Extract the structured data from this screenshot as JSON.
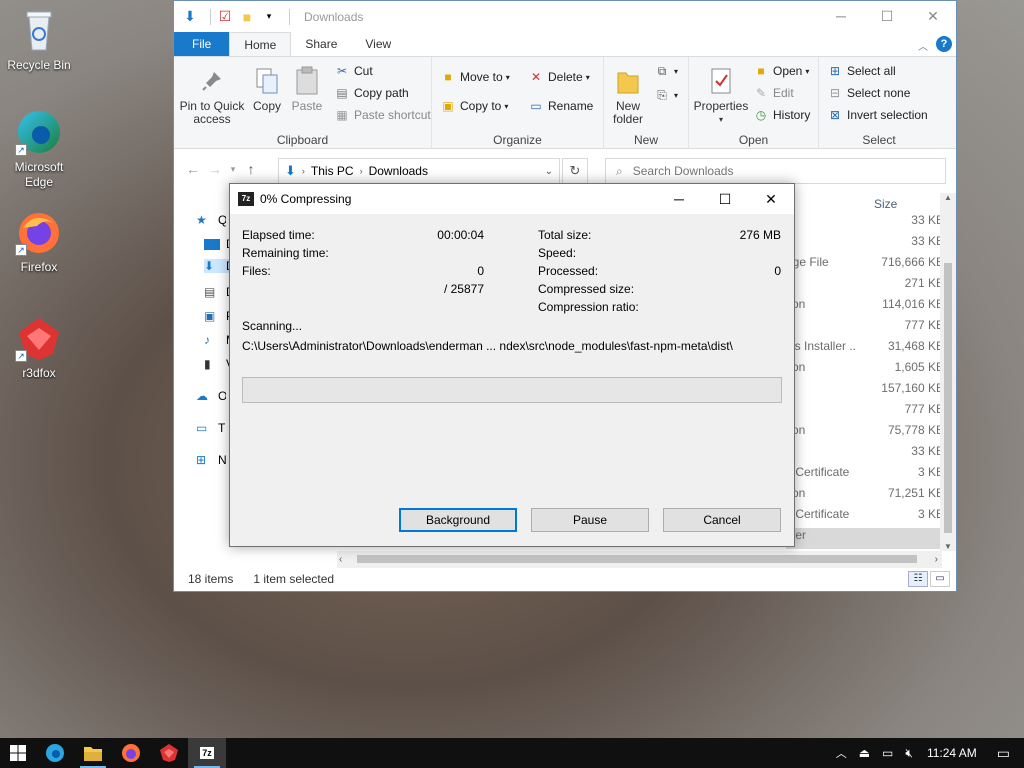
{
  "desktop": {
    "icons": [
      {
        "label": "Recycle Bin",
        "icon": "recycle-bin-icon"
      },
      {
        "label": "Microsoft Edge",
        "icon": "edge-icon"
      },
      {
        "label": "Firefox",
        "icon": "firefox-icon"
      },
      {
        "label": "r3dfox",
        "icon": "r3dfox-icon"
      }
    ]
  },
  "explorer": {
    "title": "Downloads",
    "tabs": [
      "File",
      "Home",
      "Share",
      "View"
    ],
    "active_tab": "Home",
    "ribbon": {
      "clipboard": {
        "label": "Clipboard",
        "pin": "Pin to Quick access",
        "copy": "Copy",
        "paste": "Paste",
        "cut": "Cut",
        "copy_path": "Copy path",
        "paste_shortcut": "Paste shortcut"
      },
      "organize": {
        "label": "Organize",
        "move_to": "Move to",
        "copy_to": "Copy to",
        "delete": "Delete",
        "rename": "Rename"
      },
      "new": {
        "label": "New",
        "new_folder": "New folder"
      },
      "open": {
        "label": "Open",
        "properties": "Properties",
        "open": "Open",
        "edit": "Edit",
        "history": "History"
      },
      "select": {
        "label": "Select",
        "select_all": "Select all",
        "select_none": "Select none",
        "invert": "Invert selection"
      }
    },
    "address": {
      "crumbs": [
        "This PC",
        "Downloads"
      ],
      "search_placeholder": "Search Downloads"
    },
    "nav_items": [
      "Qu",
      "D",
      "D",
      "D",
      "P",
      "M",
      "V",
      "On",
      "Th",
      "Ne"
    ],
    "columns": {
      "size": "Size"
    },
    "rows": [
      {
        "type": "",
        "size": "33 KB"
      },
      {
        "type": "",
        "size": "33 KB"
      },
      {
        "type": "age File",
        "size": "716,666 KB"
      },
      {
        "type": "e",
        "size": "271 KB"
      },
      {
        "type": "tion",
        "size": "114,016 KB"
      },
      {
        "type": "e",
        "size": "777 KB"
      },
      {
        "type": "ws Installer ...",
        "size": "31,468 KB"
      },
      {
        "type": "tion",
        "size": "1,605 KB"
      },
      {
        "type": "e",
        "size": "157,160 KB"
      },
      {
        "type": "e",
        "size": "777 KB"
      },
      {
        "type": "tion",
        "size": "75,778 KB"
      },
      {
        "type": "",
        "size": "33 KB"
      },
      {
        "type": "y Certificate",
        "size": "3 KB"
      },
      {
        "type": "tion",
        "size": "71,251 KB"
      },
      {
        "type": "y Certificate",
        "size": "3 KB"
      },
      {
        "type": "lder",
        "size": ""
      }
    ],
    "status": {
      "items": "18 items",
      "selected": "1 item selected"
    }
  },
  "zip_dialog": {
    "title": "0% Compressing",
    "elapsed_label": "Elapsed time:",
    "elapsed_value": "00:00:04",
    "remaining_label": "Remaining time:",
    "files_label": "Files:",
    "files_value": "0",
    "files_total": "/ 25877",
    "total_size_label": "Total size:",
    "total_size_value": "276 MB",
    "speed_label": "Speed:",
    "processed_label": "Processed:",
    "processed_value": "0",
    "compressed_size_label": "Compressed size:",
    "compression_ratio_label": "Compression ratio:",
    "scanning_label": "Scanning...",
    "scanning_path": "C:\\Users\\Administrator\\Downloads\\enderman ... ndex\\src\\node_modules\\fast-npm-meta\\dist\\",
    "progress": 0,
    "buttons": {
      "background": "Background",
      "pause": "Pause",
      "cancel": "Cancel"
    }
  },
  "taskbar": {
    "clock": "11:24 AM",
    "apps": [
      "start-icon",
      "edge-icon",
      "file-explorer-icon",
      "firefox-icon",
      "r3dfox-icon",
      "7zip-icon"
    ]
  }
}
